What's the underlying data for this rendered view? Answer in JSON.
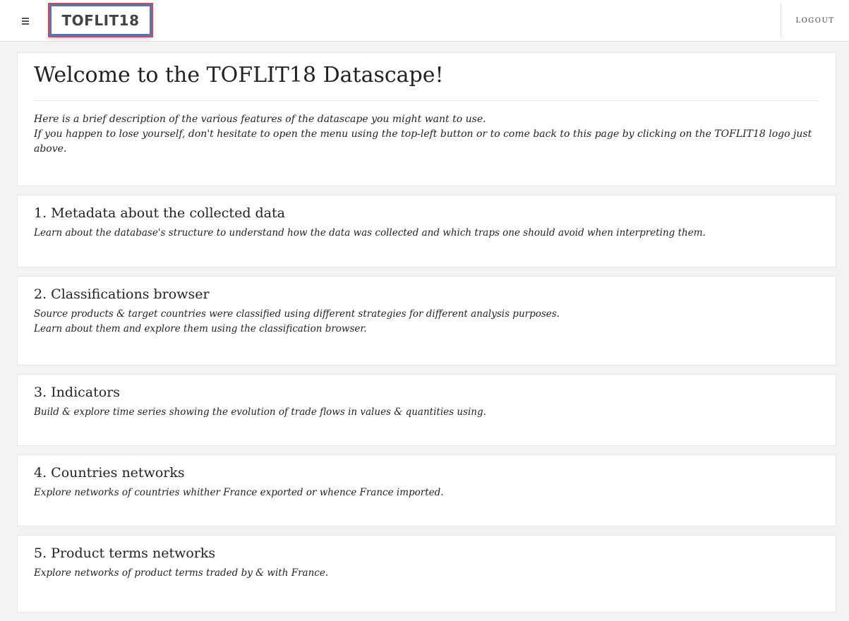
{
  "header": {
    "logo_text": "TOFLIT18",
    "logout_label": "LOGOUT"
  },
  "welcome": {
    "title": "Welcome to the TOFLIT18 Datascape!",
    "line1": "Here is a brief description of the various features of the datascape you might want to use.",
    "line2": "If you happen to lose yourself, don't hesitate to open the menu using the top-left button or to come back to this page by clicking on the TOFLIT18 logo just above."
  },
  "features": [
    {
      "title": "1. Metadata about the collected data",
      "lines": [
        "Learn about the database's structure to understand how the data was collected and which traps one should avoid when interpreting them."
      ]
    },
    {
      "title": "2. Classifications browser",
      "lines": [
        "Source products & target countries were classified using different strategies for different analysis purposes.",
        "Learn about them and explore them using the classification browser."
      ]
    },
    {
      "title": "3. Indicators",
      "lines": [
        "Build & explore time series showing the evolution of trade flows in values & quantities using."
      ]
    },
    {
      "title": "4. Countries networks",
      "lines": [
        "Explore networks of countries whither France exported or whence France imported."
      ]
    },
    {
      "title": "5. Product terms networks",
      "lines": [
        "Explore networks of product terms traded by & with France."
      ]
    }
  ]
}
